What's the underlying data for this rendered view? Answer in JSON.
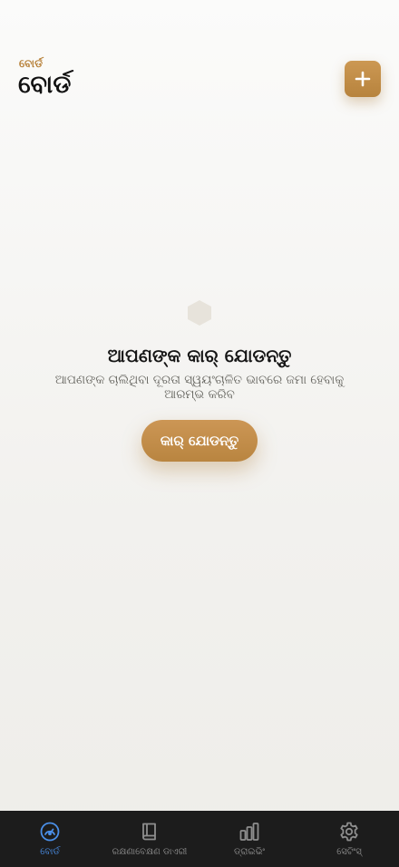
{
  "header": {
    "eyebrow": "ବୋର୍ଡ",
    "title": "ବୋର୍ଡ",
    "add_icon": "plus-icon"
  },
  "empty_state": {
    "icon": "hexagon-icon",
    "title": "ଆପଣଙ୍କ କାର୍ ଯୋଡନ୍ତୁ",
    "description": "ଆପଣଙ୍କ ଚାଲିଥିବା ଦୂରତା ସ୍ୱୟଂଚାଳିତ ଭାବରେ ଜମା ହେବାକୁ ଆରମ୍ଭ କରିବ",
    "button_label": "କାର୍ ଯୋଡନ୍ତୁ"
  },
  "tabbar": {
    "items": [
      {
        "label": "ବୋର୍ଡ",
        "icon": "gauge-icon",
        "active": true
      },
      {
        "label": "ରକ୍ଷଣାବେକ୍ଷଣ ଡାଏରୀ",
        "icon": "book-icon",
        "active": false
      },
      {
        "label": "ଡ୍ରାଇଭିଂ",
        "icon": "bar-chart-icon",
        "active": false
      },
      {
        "label": "ସେଟିଂସ୍",
        "icon": "gear-icon",
        "active": false
      }
    ]
  },
  "colors": {
    "accent": "#c08a45",
    "active_tab": "#4a8fe8",
    "tabbar_bg": "#1c1c1c"
  }
}
